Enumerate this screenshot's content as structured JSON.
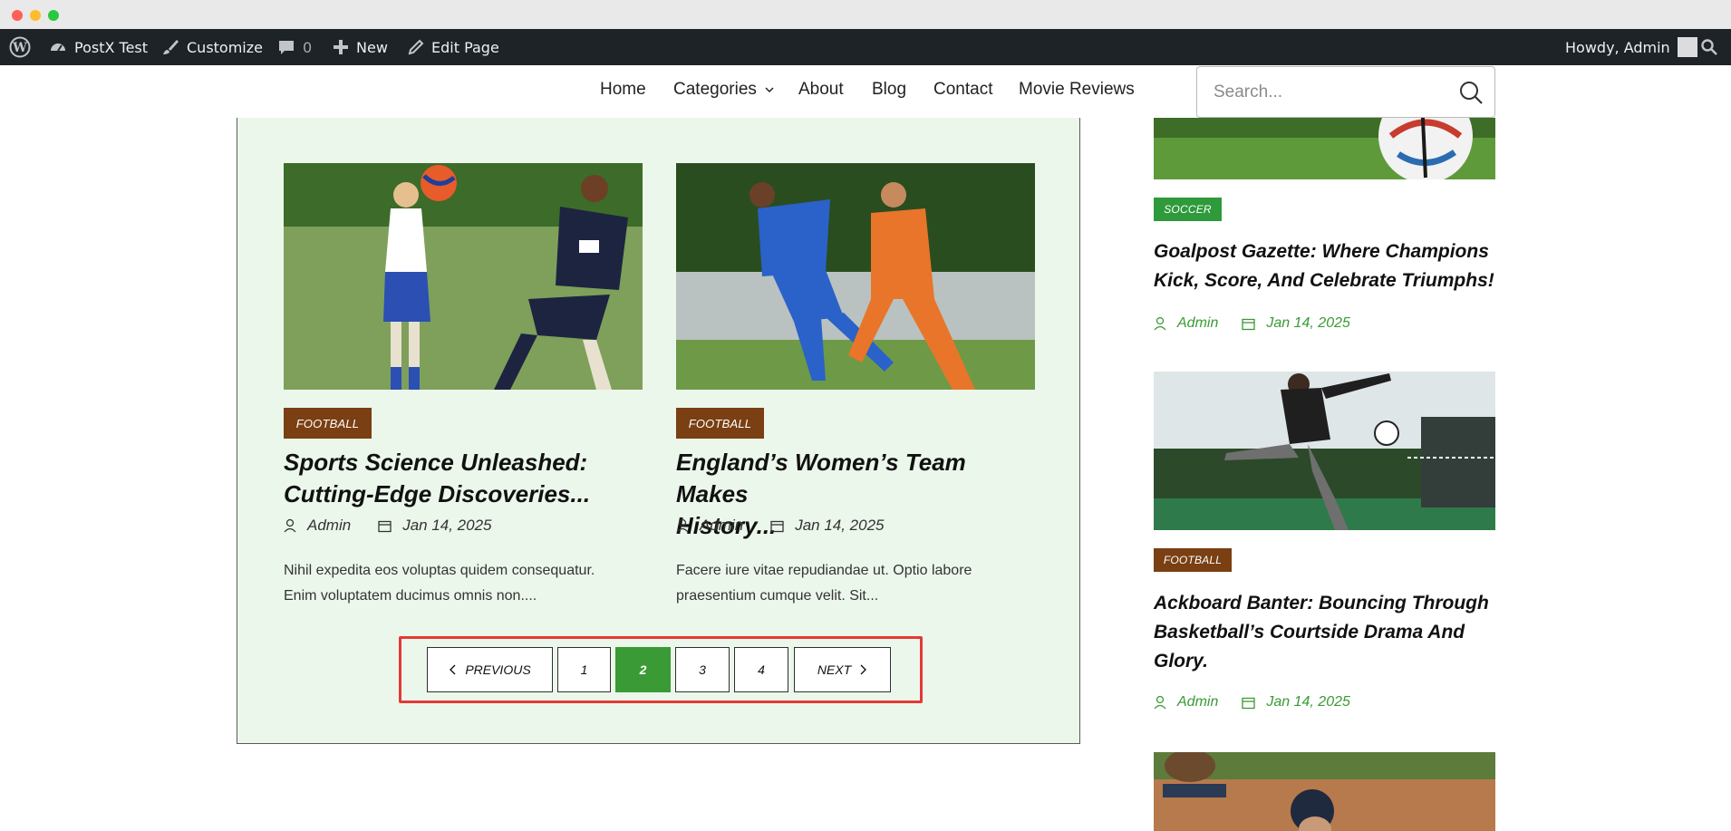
{
  "admin_bar": {
    "site_name": "PostX Test",
    "customize": "Customize",
    "comments_count": "0",
    "new": "New",
    "edit_page": "Edit Page",
    "greeting": "Howdy, Admin"
  },
  "nav": {
    "items": [
      "Home",
      "Categories",
      "About",
      "Blog",
      "Contact",
      "Movie Reviews"
    ],
    "search_placeholder": "Search..."
  },
  "posts": [
    {
      "category": "FOOTBALL",
      "title_line1": "Sports Science Unleashed:",
      "title_line2": "Cutting-Edge Discoveries...",
      "author": "Admin",
      "date": "Jan 14, 2025",
      "excerpt_line1": "Nihil expedita eos voluptas quidem consequatur.",
      "excerpt_line2": "Enim voluptatem ducimus omnis non...."
    },
    {
      "category": "FOOTBALL",
      "title_line1": "England’s Women’s Team Makes",
      "title_line2": "History...",
      "author": "Admin",
      "date": "Jan 14, 2025",
      "excerpt_line1": "Facere iure vitae repudiandae ut. Optio labore",
      "excerpt_line2": "praesentium cumque velit. Sit..."
    }
  ],
  "pagination": {
    "previous": "PREVIOUS",
    "pages": [
      "1",
      "2",
      "3",
      "4"
    ],
    "current": "2",
    "next": "NEXT"
  },
  "sidebar": [
    {
      "category": "SOCCER",
      "title_line1": "Goalpost Gazette: Where Champions",
      "title_line2": "Kick, Score, And Celebrate Triumphs!",
      "author": "Admin",
      "date": "Jan 14, 2025"
    },
    {
      "category": "FOOTBALL",
      "title_line1": "Ackboard Banter: Bouncing Through",
      "title_line2": "Basketball’s Courtside Drama And",
      "title_line3": "Glory.",
      "author": "Admin",
      "date": "Jan 14, 2025"
    }
  ],
  "colors": {
    "accent_green": "#3a9a35",
    "badge_football": "#7a3f12",
    "badge_soccer": "#2e9a3b",
    "panel_bg": "#ecf7ec",
    "admin_bar_bg": "#1d2327",
    "highlight_red": "#e53935"
  }
}
